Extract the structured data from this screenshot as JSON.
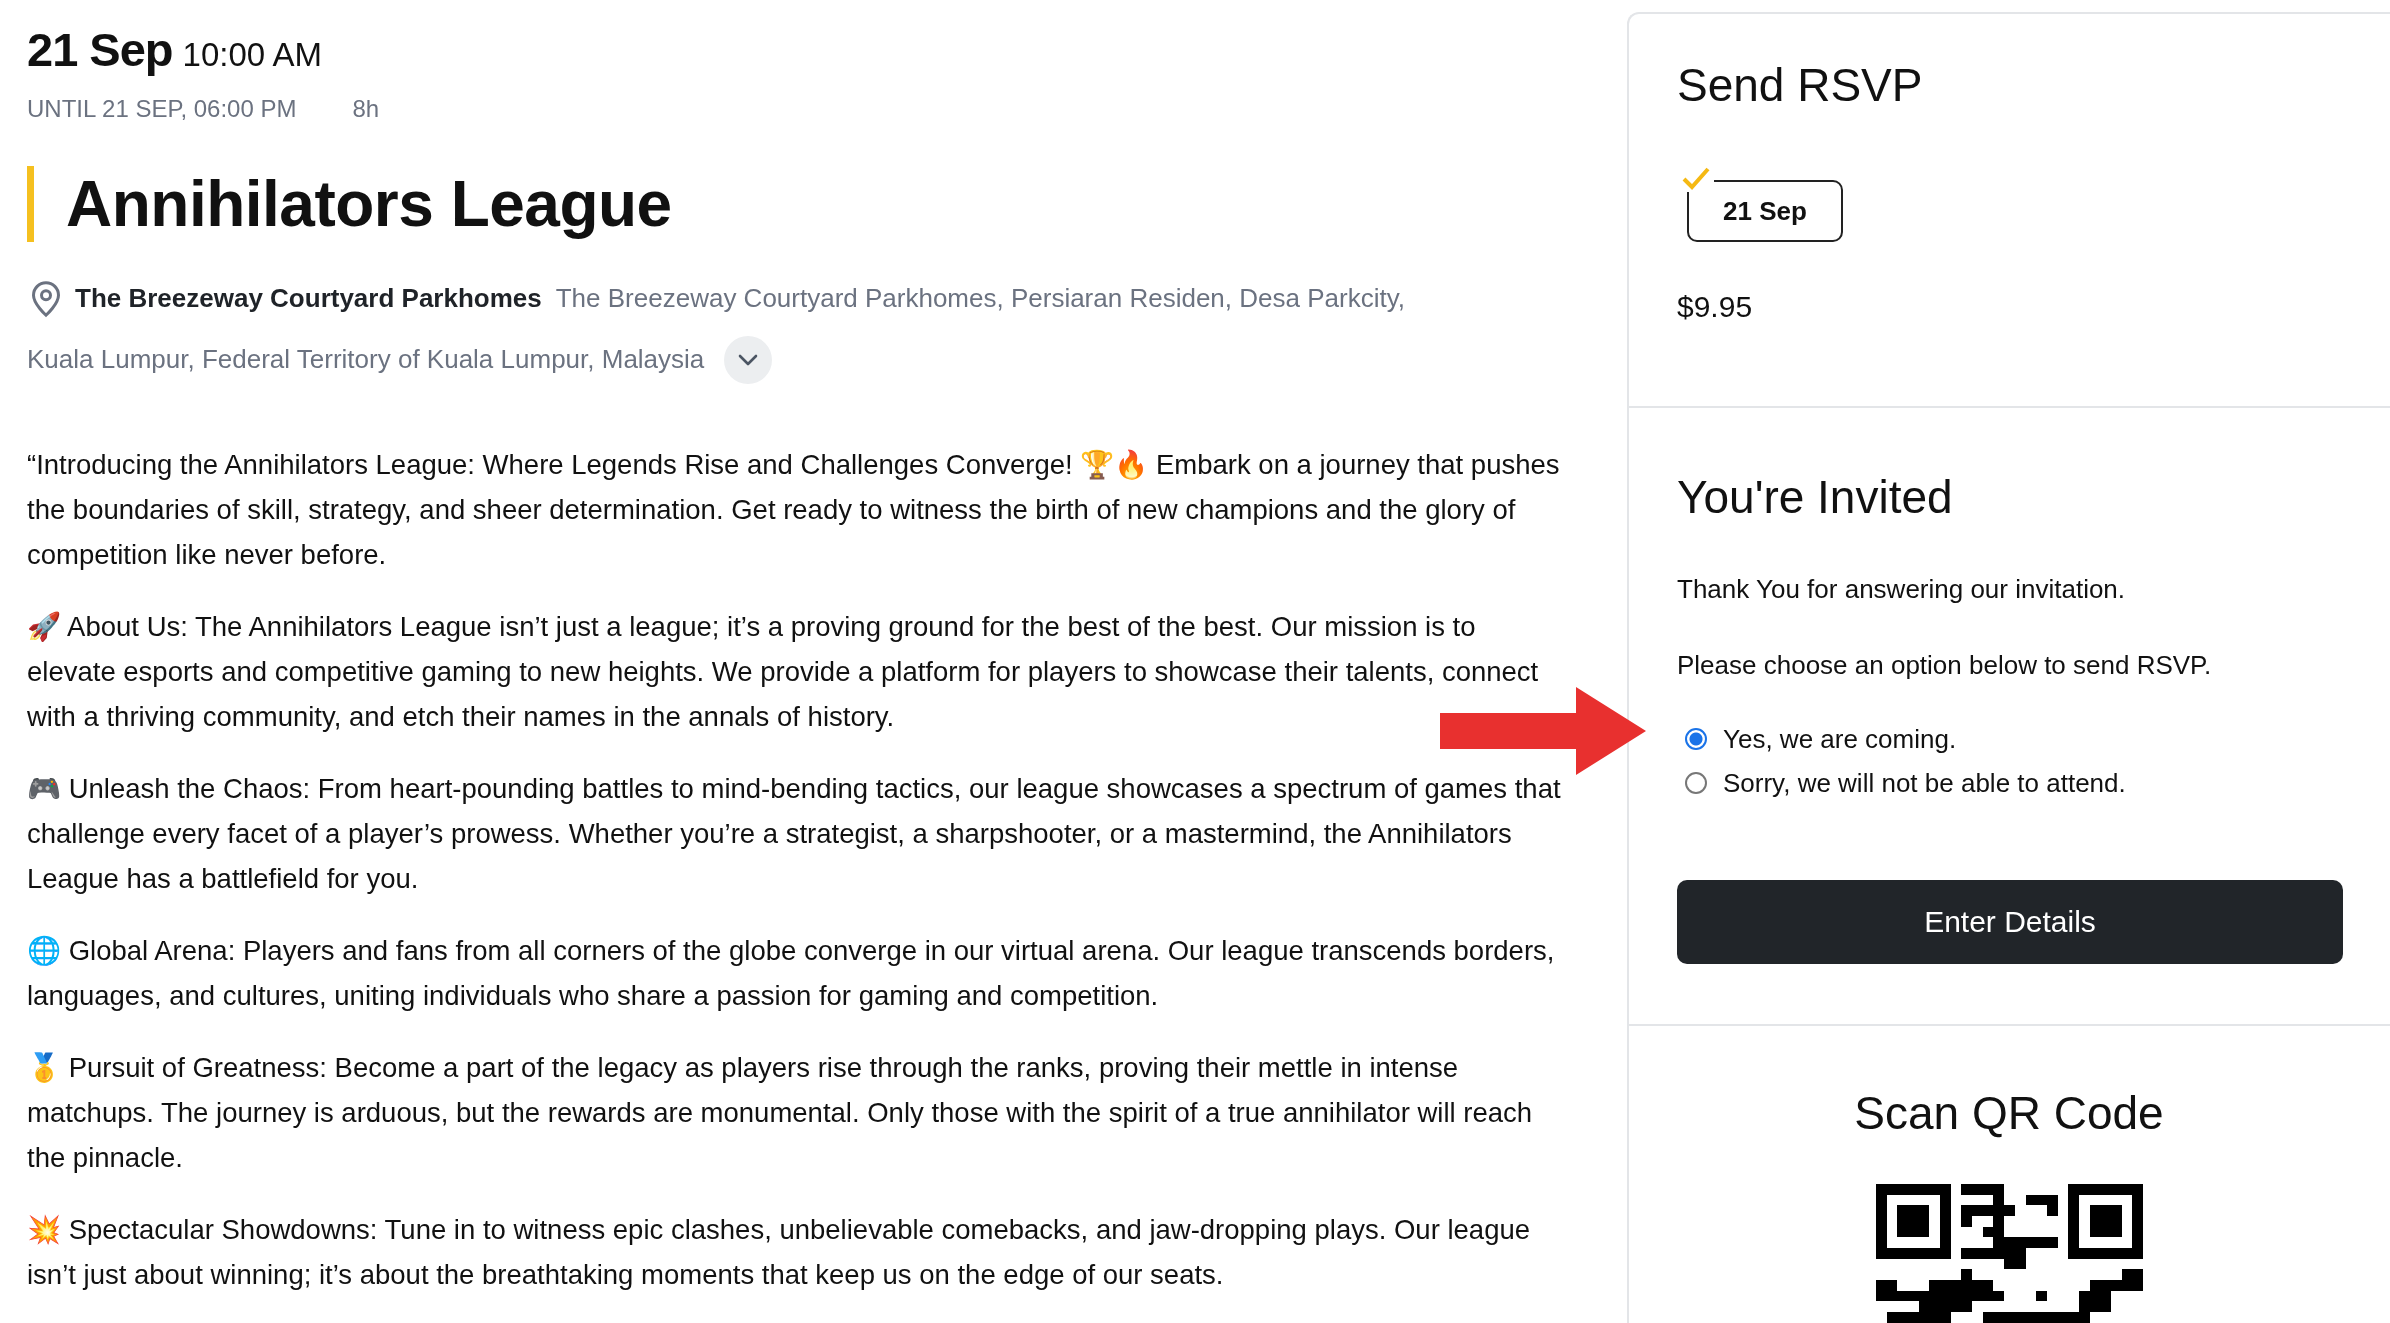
{
  "event": {
    "date": "21 Sep",
    "time": "10:00 AM",
    "until": "UNTIL 21 SEP, 06:00 PM",
    "duration": "8h",
    "title": "Annihilators League",
    "venue_name": "The Breezeway Courtyard Parkhomes",
    "address_lines": [
      "The Breezeway Courtyard Parkhomes, Persiaran Residen, Desa Parkcity,",
      "Kuala Lumpur, Federal Territory of Kuala Lumpur, Malaysia"
    ],
    "address_expanded": false
  },
  "description": [
    "“Introducing the Annihilators League: Where Legends Rise and Challenges Converge! 🏆🔥 Embark on a journey that pushes the boundaries of skill, strategy, and sheer determination. Get ready to witness the birth of new champions and the glory of competition like never before.",
    "🚀 About Us: The Annihilators League isn’t just a league; it’s a proving ground for the best of the best. Our mission is to elevate esports and competitive gaming to new heights. We provide a platform for players to showcase their talents, connect with a thriving community, and etch their names in the annals of history.",
    "🎮 Unleash the Chaos: From heart-pounding battles to mind-bending tactics, our league showcases a spectrum of games that challenge every facet of a player’s prowess. Whether you’re a strategist, a sharpshooter, or a mastermind, the Annihilators League has a battlefield for you.",
    "🌐 Global Arena: Players and fans from all corners of the globe converge in our virtual arena. Our league transcends borders, languages, and cultures, uniting individuals who share a passion for gaming and competition.",
    "🥇 Pursuit of Greatness: Become a part of the legacy as players rise through the ranks, proving their mettle in intense matchups. The journey is arduous, but the rewards are monumental. Only those with the spirit of a true annihilator will reach the pinnacle.",
    "💥 Spectacular Showdowns: Tune in to witness epic clashes, unbelievable comebacks, and jaw-dropping plays. Our league isn’t just about winning; it’s about the breathtaking moments that keep us on the edge of our seats."
  ],
  "rsvp": {
    "title": "Send RSVP",
    "dates": [
      {
        "label": "21 Sep",
        "selected": true
      }
    ],
    "price": "$9.95"
  },
  "invitation": {
    "title": "You're Invited",
    "message": "Thank You for answering our invitation.",
    "prompt": "Please choose an option below to send RSVP.",
    "options": [
      {
        "label": "Yes, we are coming.",
        "selected": true
      },
      {
        "label": "Sorry, we will not be able to attend.",
        "selected": false
      }
    ],
    "button": "Enter Details"
  },
  "qr": {
    "title": "Scan QR Code"
  }
}
